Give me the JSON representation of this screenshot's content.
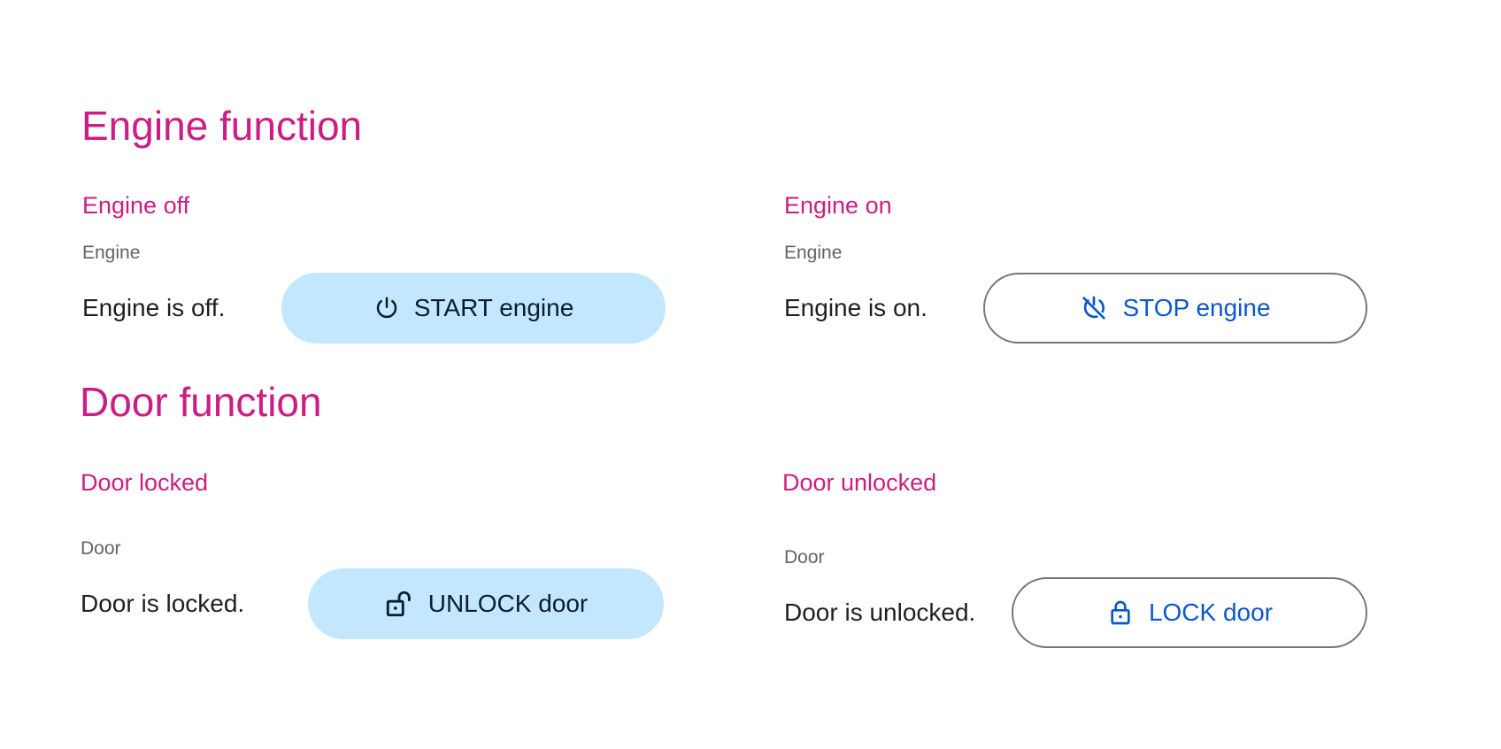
{
  "colors": {
    "heading": "#cc1d83",
    "tonal_bg": "#c2e7ff",
    "tonal_text": "#0b1d33",
    "outline_text": "#0b57d0",
    "outline_border": "#747775",
    "label": "#5f6368",
    "status": "#1f1f1f"
  },
  "engine_section": {
    "title": "Engine function",
    "off_card": {
      "title": "Engine off",
      "label": "Engine",
      "status": "Engine is off.",
      "button_label": "START engine",
      "button_icon": "power-icon"
    },
    "on_card": {
      "title": "Engine on",
      "label": "Engine",
      "status": "Engine is on.",
      "button_label": "STOP engine",
      "button_icon": "power-off-icon"
    }
  },
  "door_section": {
    "title": "Door function",
    "locked_card": {
      "title": "Door locked",
      "label": "Door",
      "status": "Door is locked.",
      "button_label": "UNLOCK door",
      "button_icon": "lock-open-icon"
    },
    "unlocked_card": {
      "title": "Door unlocked",
      "label": "Door",
      "status": "Door is unlocked.",
      "button_label": "LOCK door",
      "button_icon": "lock-icon"
    }
  }
}
